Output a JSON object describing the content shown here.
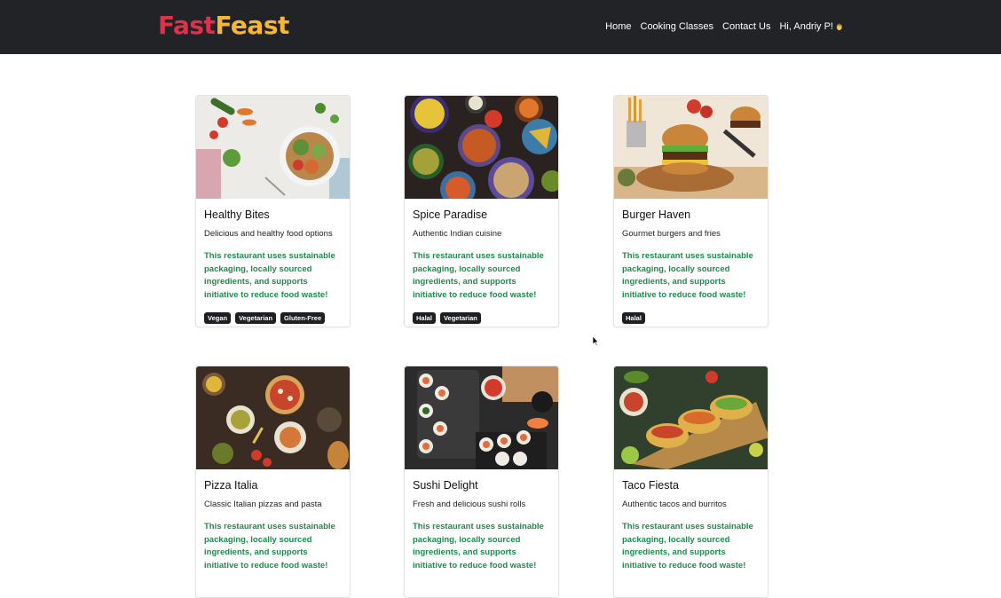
{
  "brand": {
    "part1": "Fast",
    "part2": "Feast"
  },
  "nav": {
    "home": "Home",
    "classes": "Cooking Classes",
    "contact": "Contact Us",
    "greeting": "Hi, Andriy P!",
    "wave_icon": "waving-hand-icon"
  },
  "restaurants": [
    {
      "name": "Healthy Bites",
      "description": "Delicious and healthy food options",
      "eco": "This restaurant uses sustainable packaging, locally sourced ingredients, and supports initiative to reduce food waste!",
      "tags": [
        "Vegan",
        "Vegetarian",
        "Gluten-Free"
      ]
    },
    {
      "name": "Spice Paradise",
      "description": "Authentic Indian cuisine",
      "eco": "This restaurant uses sustainable packaging, locally sourced ingredients, and supports initiative to reduce food waste!",
      "tags": [
        "Halal",
        "Vegetarian"
      ]
    },
    {
      "name": "Burger Haven",
      "description": "Gourmet burgers and fries",
      "eco": "This restaurant uses sustainable packaging, locally sourced ingredients, and supports initiative to reduce food waste!",
      "tags": [
        "Halal"
      ]
    },
    {
      "name": "Pizza Italia",
      "description": "Classic Italian pizzas and pasta",
      "eco": "This restaurant uses sustainable packaging, locally sourced ingredients, and supports initiative to reduce food waste!",
      "tags": []
    },
    {
      "name": "Sushi Delight",
      "description": "Fresh and delicious sushi rolls",
      "eco": "This restaurant uses sustainable packaging, locally sourced ingredients, and supports initiative to reduce food waste!",
      "tags": []
    },
    {
      "name": "Taco Fiesta",
      "description": "Authentic tacos and burritos",
      "eco": "This restaurant uses sustainable packaging, locally sourced ingredients, and supports initiative to reduce food waste!",
      "tags": []
    }
  ],
  "colors": {
    "navbar": "#222327",
    "brand_red": "#e0304a",
    "brand_yellow": "#f7b731",
    "eco_green": "#1f8a4c",
    "tag_bg": "#1e1f22"
  }
}
